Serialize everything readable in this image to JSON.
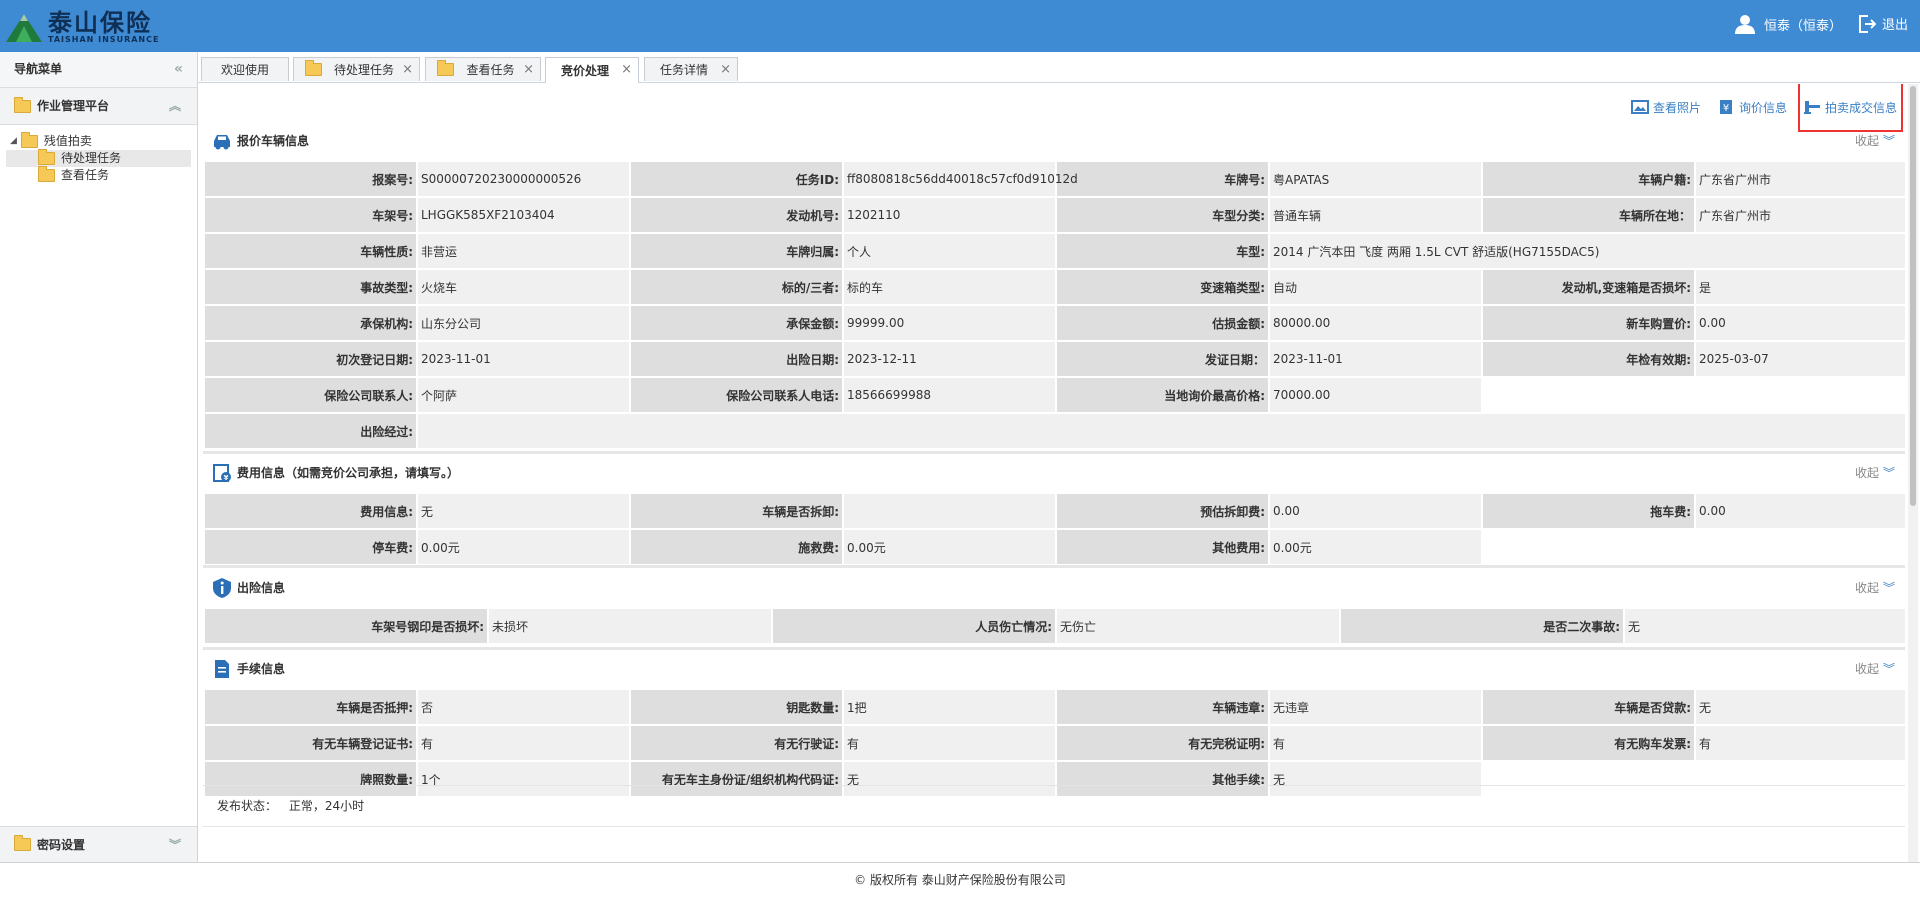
{
  "header": {
    "logo_cn": "泰山保险",
    "logo_en": "TAISHAN INSURANCE",
    "user": "恒泰（恒泰）",
    "logout": "退出"
  },
  "sidebar": {
    "title": "导航菜单",
    "group": "作业管理平台",
    "tree": {
      "root": "残值拍卖",
      "children": [
        "待处理任务",
        "查看任务"
      ]
    },
    "bottom": "密码设置"
  },
  "tabs": [
    {
      "label": "欢迎使用"
    },
    {
      "label": "待处理任务"
    },
    {
      "label": "查看任务"
    },
    {
      "label": "竞价处理"
    },
    {
      "label": "任务详情"
    }
  ],
  "toolbar": {
    "photos": "查看照片",
    "inquiry": "询价信息",
    "auction": "拍卖成交信息"
  },
  "fold_label": "收起",
  "vehicle": {
    "title": "报价车辆信息",
    "rows": [
      [
        [
          "报案号:",
          "S00000720230000000526"
        ],
        [
          "任务ID:",
          "ff8080818c56dd40018c57cf0d91012d"
        ],
        [
          "车牌号:",
          "粤APATAS"
        ],
        [
          "车辆户籍:",
          "广东省广州市"
        ]
      ],
      [
        [
          "车架号:",
          "LHGGK585XF2103404"
        ],
        [
          "发动机号:",
          "1202110"
        ],
        [
          "车型分类:",
          "普通车辆"
        ],
        [
          "车辆所在地：",
          "广东省广州市"
        ]
      ],
      [
        [
          "车辆性质:",
          "非营运"
        ],
        [
          "车牌归属:",
          "个人"
        ],
        [
          "车型:",
          "2014 广汽本田 飞度 两厢 1.5L CVT 舒适版(HG7155DAC5)"
        ]
      ],
      [
        [
          "事故类型:",
          "火烧车"
        ],
        [
          "标的/三者:",
          "标的车"
        ],
        [
          "变速箱类型:",
          "自动"
        ],
        [
          "发动机,变速箱是否损坏:",
          "是"
        ]
      ],
      [
        [
          "承保机构:",
          "山东分公司"
        ],
        [
          "承保金额:",
          "99999.00"
        ],
        [
          "估损金额:",
          "80000.00"
        ],
        [
          "新车购置价:",
          "0.00"
        ]
      ],
      [
        [
          "初次登记日期:",
          "2023-11-01"
        ],
        [
          "出险日期:",
          "2023-12-11"
        ],
        [
          "发证日期：",
          "2023-11-01"
        ],
        [
          "年检有效期:",
          "2025-03-07"
        ]
      ],
      [
        [
          "保险公司联系人:",
          "个阿萨"
        ],
        [
          "保险公司联系人电话:",
          "18566699988"
        ],
        [
          "当地询价最高价格:",
          "70000.00"
        ]
      ],
      [
        [
          "出险经过:",
          ""
        ]
      ]
    ]
  },
  "fees": {
    "title": "费用信息（如需竞价公司承担，请填写。）",
    "rows": [
      [
        [
          "费用信息:",
          "无"
        ],
        [
          "车辆是否拆卸:",
          ""
        ],
        [
          "预估拆卸费:",
          "0.00"
        ],
        [
          "拖车费:",
          "0.00"
        ]
      ],
      [
        [
          "停车费:",
          "0.00元"
        ],
        [
          "施救费:",
          "0.00元"
        ],
        [
          "其他费用:",
          "0.00元"
        ]
      ]
    ]
  },
  "accident": {
    "title": "出险信息",
    "rows": [
      [
        [
          "车架号钢印是否损坏:",
          "未损坏"
        ],
        [
          "人员伤亡情况:",
          "无伤亡"
        ],
        [
          "是否二次事故:",
          "无"
        ]
      ]
    ]
  },
  "procedures": {
    "title": "手续信息",
    "rows": [
      [
        [
          "车辆是否抵押:",
          "否"
        ],
        [
          "钥匙数量:",
          "1把"
        ],
        [
          "车辆违章:",
          "无违章"
        ],
        [
          "车辆是否贷款:",
          "无"
        ]
      ],
      [
        [
          "有无车辆登记证书:",
          "有"
        ],
        [
          "有无行驶证:",
          "有"
        ],
        [
          "有无完税证明:",
          "有"
        ],
        [
          "有无购车发票:",
          "有"
        ]
      ],
      [
        [
          "牌照数量:",
          "1个"
        ],
        [
          "有无车主身份证/组织机构代码证:",
          "无"
        ],
        [
          "其他手续:",
          "无"
        ]
      ]
    ]
  },
  "status": {
    "label": "发布状态：",
    "value": "正常，24小时"
  },
  "footer": "© 版权所有 泰山财产保险股份有限公司"
}
